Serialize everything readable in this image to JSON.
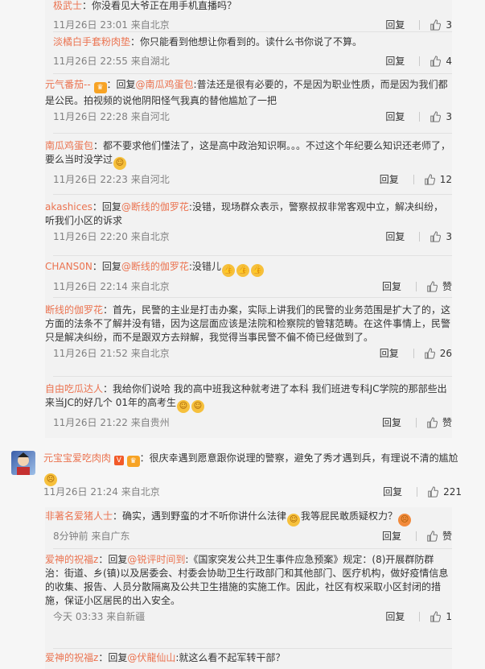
{
  "top_partial": {
    "name": "极武士",
    "text": "：你没看见大爷正在用手机直播吗？"
  },
  "replies_top": [
    {
      "name": "淡橘白手套粉肉垫",
      "text": "：你只能看到他想让你看到的。读什么书你说了不算。",
      "time": "11月26日 22:55 来自湖北",
      "likes": "4"
    },
    {
      "name": "元气番茄--",
      "prefix": "：回复",
      "mention": "@南瓜鸡蛋包",
      "text": ":普法还是很有必要的，不是因为职业性质，而是因为我们都是公民。拍视频的说他阴阳怪气我真的替他尴尬了一把",
      "time": "11月26日 22:28 来自河北",
      "likes": "3"
    },
    {
      "name": "南瓜鸡蛋包",
      "text": "：都不要求他们懂法了，这是高中政治知识啊。。。不过这个年纪要么知识还老师了，要么当时没学过",
      "time": "11月26日 22:23 来自河北",
      "likes": "12"
    },
    {
      "name": "akashices",
      "prefix": "：回复",
      "mention": "@断线的伽罗花",
      "text": ":没错，现场群众表示，警察叔叔非常客观中立，解决纠纷，听我们小区的诉求",
      "time": "11月26日 22:20 来自北京",
      "likes": "3"
    },
    {
      "name": "CHANS0N",
      "prefix": "：回复",
      "mention": "@断线的伽罗花",
      "text": ":没错儿",
      "time": "11月26日 22:14 来自北京",
      "likes": "赞"
    },
    {
      "name": "断线的伽罗花",
      "text": "：首先，民警的主业是打击办案，实际上讲我们的民警的业务范围是扩大了的，这方面的法条不了解并没有错，因为这层面应该是法院和检察院的管辖范畴。在这件事情上，民警只是解决纠纷，而不是跟双方去辩解，我觉得当事民警不偏不倚已经做到了。",
      "time": "11月26日 21:52 来自北京",
      "likes": "26"
    },
    {
      "name": "自由吃瓜达人",
      "text": "：我给你们说哈 我的高中班我这种就考进了本科 我们班进专科JC学院的那部些出来当JC的好几个 01年的高考生",
      "time": "11月26日 21:22 来自贵州",
      "likes": "赞"
    }
  ],
  "first_time": "11月26日 23:01 来自北京",
  "first_likes": "3",
  "main_comment": {
    "name": "元宝宝爱吃肉肉",
    "text": "：很庆幸遇到愿意跟你说理的警察，避免了秀才遇到兵，有理说不清的尴尬",
    "time": "11月26日 21:24 来自北京",
    "likes": "221"
  },
  "replies_bottom": [
    {
      "name": "非著名爱猪人士",
      "text": "：确实，遇到野蛮的才不听你讲什么法律",
      "text2": "我等屁民敢质疑权力？",
      "time": "8分钟前 来自广东",
      "likes": "赞"
    },
    {
      "name": "爱神的祝福z",
      "prefix": "：回复",
      "mention": "@锐评时间到",
      "text": ":《国家突发公共卫生事件应急预案》规定：(8)开展群防群治：街道、乡(镇)以及居委会、村委会协助卫生行政部门和其他部门、医疗机构，做好疫情信息的收集、报告、人员分散隔离及公共卫生措施的实施工作。因此，社区有权采取小区封闭的措施，保证小区居民的出入安全。",
      "time": "今天 03:33 来自新疆",
      "likes": "1"
    },
    {
      "name": "爱神的祝福z",
      "prefix": "：回复",
      "mention": "@伏龍仙山",
      "text": ":就这么看不起军转干部？"
    }
  ],
  "labels": {
    "reply": "回复"
  }
}
